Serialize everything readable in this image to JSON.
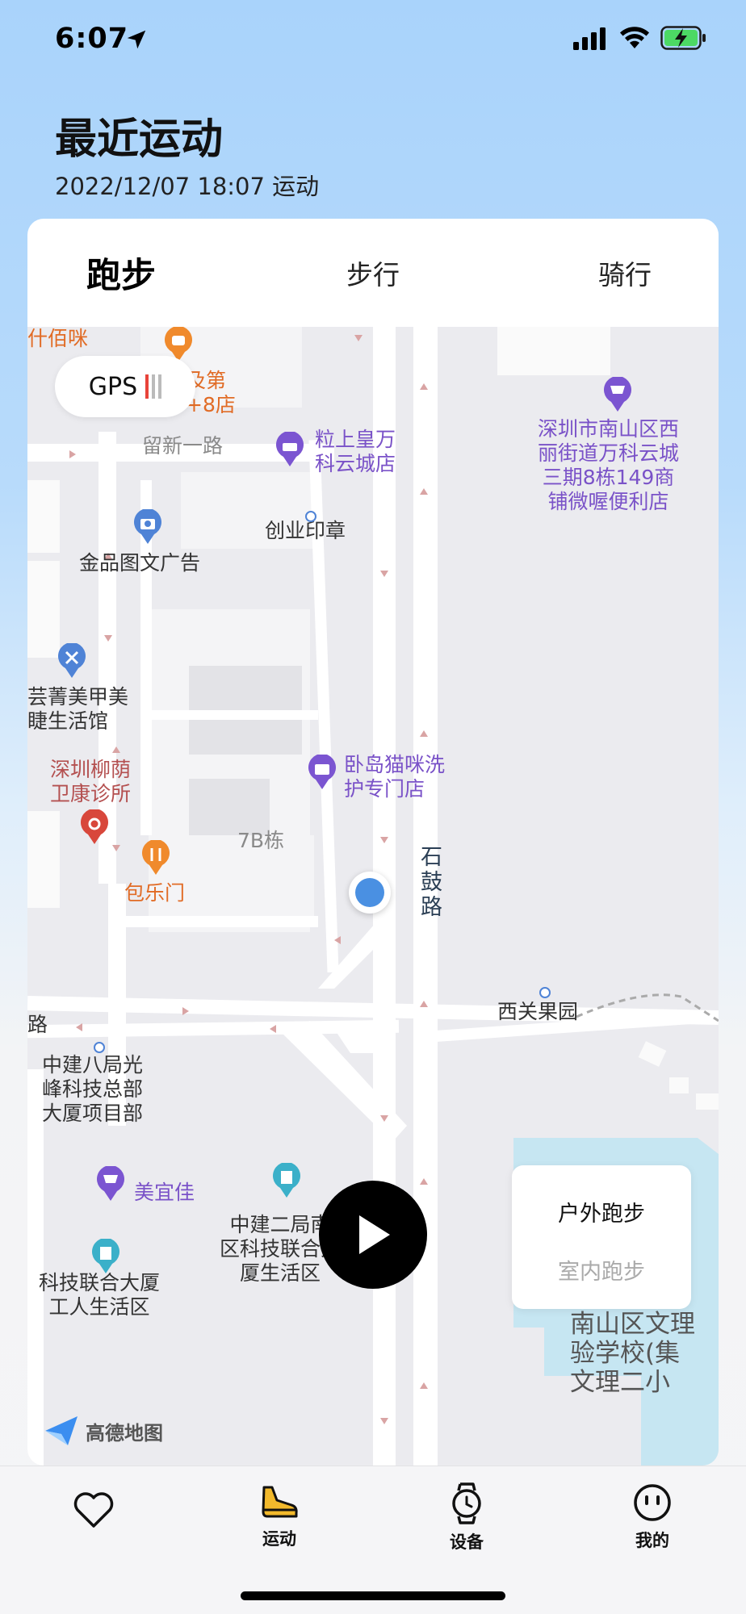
{
  "status": {
    "time": "6:07"
  },
  "header": {
    "title": "最近运动",
    "subtitle": "2022/12/07 18:07 运动"
  },
  "tabs": [
    {
      "label": "跑步",
      "active": true
    },
    {
      "label": "步行",
      "active": false
    },
    {
      "label": "骑行",
      "active": false
    }
  ],
  "gps": {
    "label": "GPS",
    "signal_bars_active": 1,
    "signal_bars_total": 3
  },
  "map": {
    "labels": {
      "top_left_cut": "什佰咪",
      "top_orange_cut": "及第\n+8店",
      "road_liuxin": "留新一路",
      "shop_lishang": "粒上皇万\n科云城店",
      "shop_shenzhen": "深圳市南山区西\n丽街道万科云城\n三期8栋149商\n铺微喔便利店",
      "chuangye": "创业印章",
      "jinpin": "金品图文广告",
      "yunjing": "芸菁美甲美\n睫生活馆",
      "clinic": "深圳柳荫\n卫康诊所",
      "woodao": "卧岛猫咪洗\n护专门店",
      "building_7b": "7B栋",
      "shigu_road": "石\n鼓\n路",
      "baolemen": "包乐门",
      "xiguan": "西关果园",
      "road_cut": "路",
      "zhongjian8": "中建八局光\n峰科技总部\n大厦项目部",
      "meiyijia": "美宜佳",
      "zhongjian2": "中建二局南\n区科技联合大\n厦生活区",
      "kejilianhe": "科技联合大厦\n工人生活区",
      "school": "南山区文理\n验学校(集\n文理二小"
    },
    "logo_text": "高德地图"
  },
  "run_modes": {
    "outdoor": "户外跑步",
    "indoor": "室内跑步"
  },
  "nav": [
    {
      "label": "",
      "icon": "heart-icon"
    },
    {
      "label": "运动",
      "icon": "running-shoe-icon"
    },
    {
      "label": "设备",
      "icon": "watch-icon"
    },
    {
      "label": "我的",
      "icon": "smiley-face-icon"
    }
  ],
  "colors": {
    "accent": "#4a90e2",
    "shoe": "#f2b92c",
    "gps_active": "#e8433a"
  }
}
